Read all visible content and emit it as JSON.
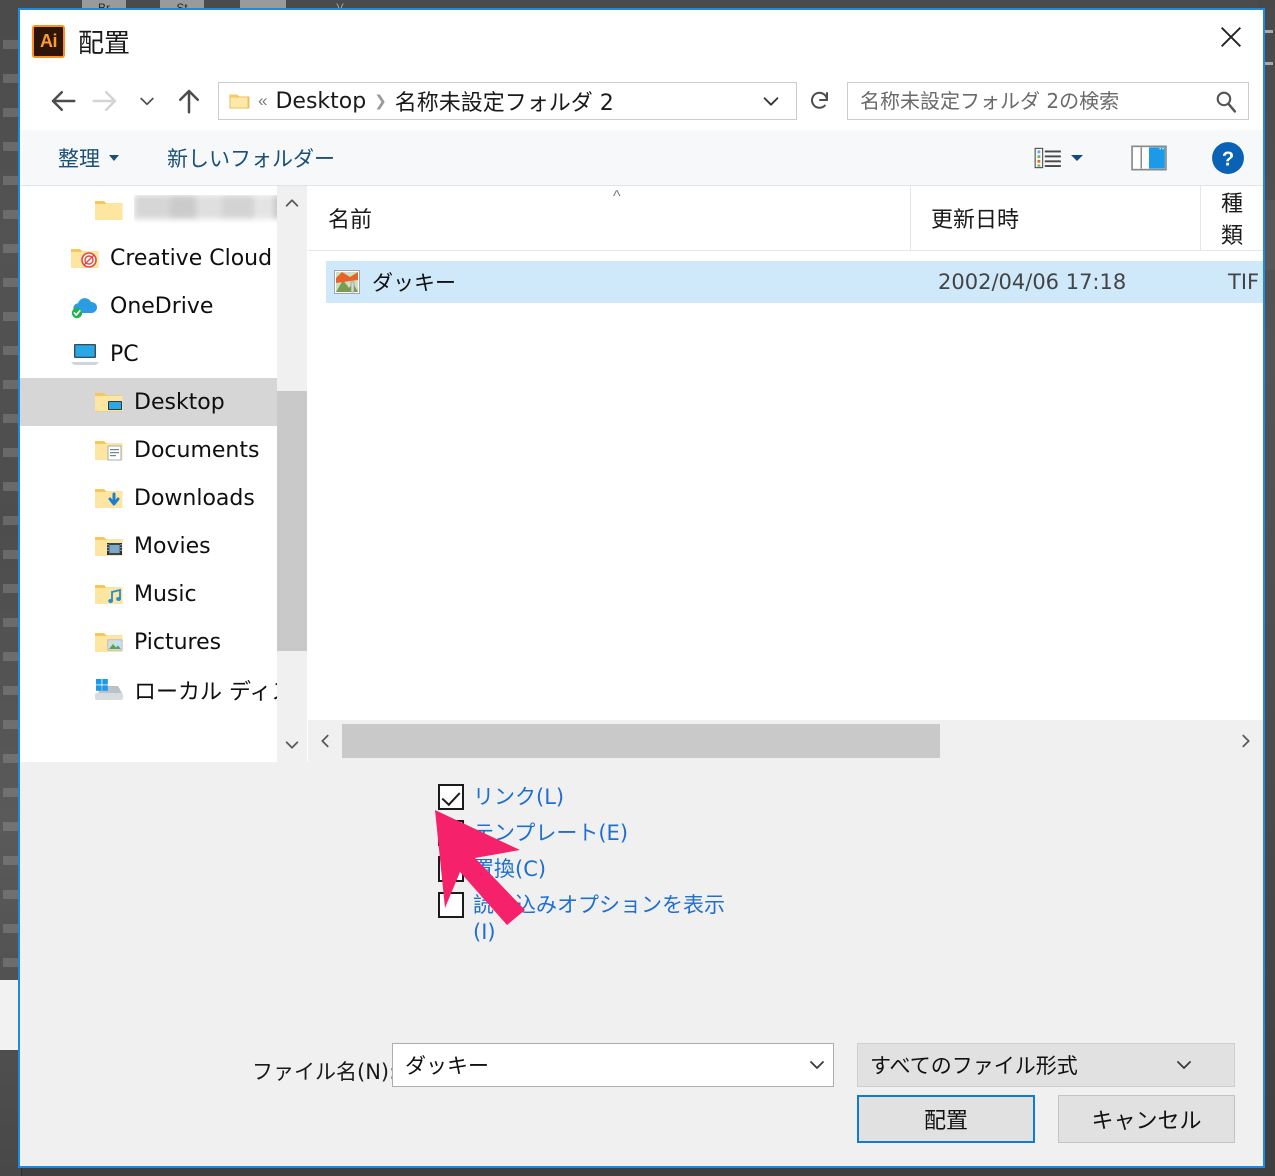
{
  "dialog": {
    "app_icon": "Ai",
    "title": "配置",
    "close_icon": "close-icon"
  },
  "nav": {
    "back": "back-arrow-icon",
    "forward": "forward-arrow-icon",
    "recent": "recent-locations-chevron-icon",
    "up": "up-arrow-icon",
    "refresh": "refresh-icon",
    "breadcrumb": {
      "folder_icon": "folder-icon",
      "overflow": "«",
      "items": [
        "Desktop",
        "名称未設定フォルダ 2"
      ],
      "separator": "❯",
      "dropdown_icon": "chevron-down-icon"
    }
  },
  "search": {
    "placeholder": "名称未設定フォルダ 2の検索",
    "value": "",
    "icon": "search-icon"
  },
  "toolbar": {
    "organize_label": "整理",
    "new_folder_label": "新しいフォルダー",
    "view_icon": "view-list-icon",
    "view_caret_icon": "chevron-down-icon",
    "preview_pane_icon": "preview-pane-icon",
    "help_icon": "help-icon"
  },
  "sidebar": {
    "items": [
      {
        "label": "",
        "icon": "folder-icon",
        "level": 2,
        "selected": false,
        "blurred": true
      },
      {
        "label": "Creative Cloud Files",
        "icon": "creative-cloud-folder-icon",
        "level": 1,
        "selected": false,
        "blurred": false
      },
      {
        "label": "OneDrive",
        "icon": "onedrive-icon",
        "level": 1,
        "selected": false,
        "blurred": false
      },
      {
        "label": "PC",
        "icon": "pc-icon",
        "level": 1,
        "selected": false,
        "blurred": false
      },
      {
        "label": "Desktop",
        "icon": "desktop-folder-icon",
        "level": 2,
        "selected": true,
        "blurred": false
      },
      {
        "label": "Documents",
        "icon": "documents-folder-icon",
        "level": 2,
        "selected": false,
        "blurred": false
      },
      {
        "label": "Downloads",
        "icon": "downloads-folder-icon",
        "level": 2,
        "selected": false,
        "blurred": false
      },
      {
        "label": "Movies",
        "icon": "movies-folder-icon",
        "level": 2,
        "selected": false,
        "blurred": false
      },
      {
        "label": "Music",
        "icon": "music-folder-icon",
        "level": 2,
        "selected": false,
        "blurred": false
      },
      {
        "label": "Pictures",
        "icon": "pictures-folder-icon",
        "level": 2,
        "selected": false,
        "blurred": false
      },
      {
        "label": "ローカル ディスク (C:",
        "icon": "local-disk-icon",
        "level": 2,
        "selected": false,
        "blurred": false
      }
    ],
    "scroll_up_icon": "chevron-up-icon",
    "scroll_down_icon": "chevron-down-icon"
  },
  "filelist": {
    "columns": [
      "名前",
      "更新日時",
      "種類"
    ],
    "sort_indicator": "^",
    "rows": [
      {
        "name": "ダッキー",
        "date": "2002/04/06 17:18",
        "type": "TIF",
        "icon": "tif-image-icon",
        "selected": true
      }
    ],
    "hscroll_left_icon": "chevron-left-icon",
    "hscroll_right_icon": "chevron-right-icon"
  },
  "options": {
    "checkboxes": [
      {
        "label": "リンク(L)",
        "checked": true
      },
      {
        "label": "テンプレート(E)",
        "checked": false
      },
      {
        "label": "置換(C)",
        "checked": false
      },
      {
        "label": "読み込みオプションを表示(I)",
        "checked": false
      }
    ]
  },
  "form": {
    "filename_label": "ファイル名(N):",
    "filename_value": "ダッキー",
    "filename_dropdown_icon": "chevron-down-icon",
    "filetype_value": "すべてのファイル形式",
    "filetype_dropdown_icon": "chevron-down-icon",
    "place_button": "配置",
    "cancel_button": "キャンセル"
  },
  "cursor": {
    "type": "arrow-pointer",
    "color": "#f5226b"
  },
  "background": {
    "top_items": [
      "Br",
      "St",
      "",
      ")("
    ]
  },
  "colors": {
    "accent_border": "#1a8ae5",
    "selection_blue": "#cfe8fa",
    "link_blue": "#1f6fd0",
    "toolbar_blue": "#1a4f77",
    "panel_grey": "#f0f0f0"
  }
}
